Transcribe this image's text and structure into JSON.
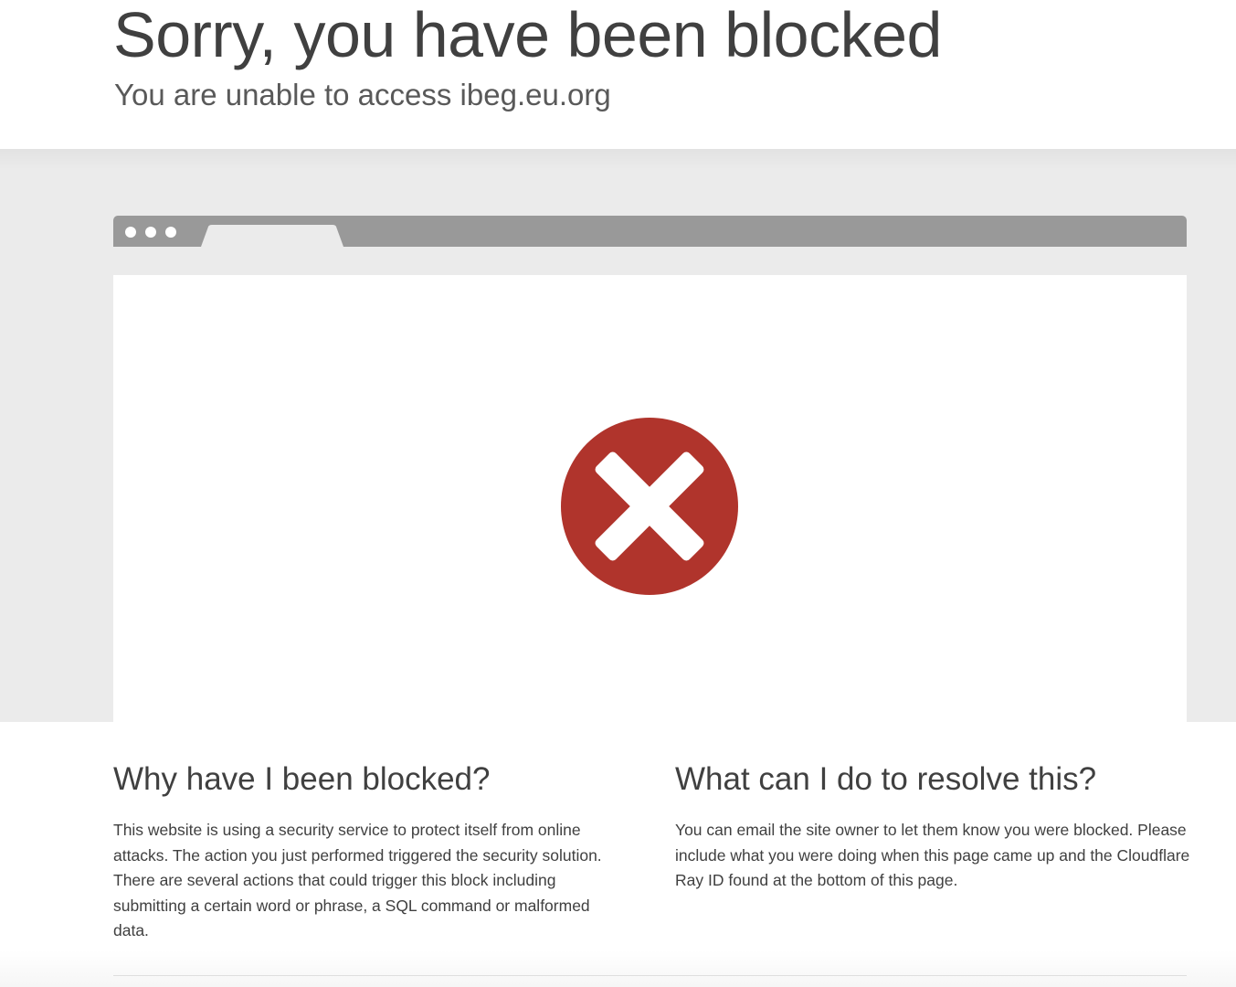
{
  "header": {
    "title": "Sorry, you have been blocked",
    "subtitle": "You are unable to access ibeg.eu.org"
  },
  "illustration": {
    "browser_dots": 3,
    "icon": "close-x-circle-icon",
    "icon_color": "#b0342c",
    "bar_color": "#999999"
  },
  "why": {
    "heading": "Why have I been blocked?",
    "body": "This website is using a security service to protect itself from online attacks. The action you just performed triggered the security solution. There are several actions that could trigger this block including submitting a certain word or phrase, a SQL command or malformed data."
  },
  "resolve": {
    "heading": "What can I do to resolve this?",
    "body": "You can email the site owner to let them know you were blocked. Please include what you were doing when this page came up and the Cloudflare Ray ID found at the bottom of this page."
  }
}
